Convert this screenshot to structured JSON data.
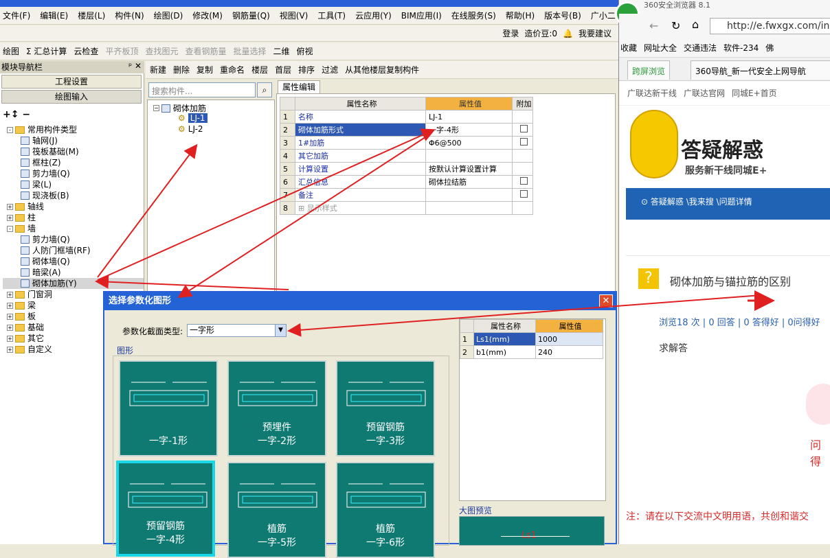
{
  "app": {
    "menu": [
      "文件(F)",
      "编辑(E)",
      "楼层(L)",
      "构件(N)",
      "绘图(D)",
      "修改(M)",
      "钢筋量(Q)",
      "视图(V)",
      "工具(T)",
      "云应用(Y)",
      "BIM应用(I)",
      "在线服务(S)",
      "帮助(H)",
      "版本号(B)",
      "广小二"
    ],
    "login": {
      "login_label": "登录",
      "price_label": "造价豆:0",
      "suggest_label": "我要建议"
    },
    "toolbar": [
      "绘图",
      "Σ 汇总计算",
      "云检查",
      "平齐板顶",
      "查找图元",
      "查看钢筋量",
      "批量选择",
      "二维",
      "俯视"
    ],
    "nav": {
      "title": "模块导航栏",
      "pin": "ᵖ ✕",
      "btn_project": "工程设置",
      "btn_draw": "绘图输入"
    },
    "tree": [
      {
        "t": "常用构件类型",
        "lvl": 0,
        "kind": "folder",
        "exp": "-"
      },
      {
        "t": "轴网(J)",
        "lvl": 1,
        "kind": "item"
      },
      {
        "t": "筏板基础(M)",
        "lvl": 1,
        "kind": "item"
      },
      {
        "t": "框柱(Z)",
        "lvl": 1,
        "kind": "item"
      },
      {
        "t": "剪力墙(Q)",
        "lvl": 1,
        "kind": "item"
      },
      {
        "t": "梁(L)",
        "lvl": 1,
        "kind": "item"
      },
      {
        "t": "现浇板(B)",
        "lvl": 1,
        "kind": "item"
      },
      {
        "t": "轴线",
        "lvl": 0,
        "kind": "folder",
        "exp": "+"
      },
      {
        "t": "柱",
        "lvl": 0,
        "kind": "folder",
        "exp": "+"
      },
      {
        "t": "墙",
        "lvl": 0,
        "kind": "folder",
        "exp": "-"
      },
      {
        "t": "剪力墙(Q)",
        "lvl": 1,
        "kind": "item"
      },
      {
        "t": "人防门框墙(RF)",
        "lvl": 1,
        "kind": "item"
      },
      {
        "t": "砌体墙(Q)",
        "lvl": 1,
        "kind": "item"
      },
      {
        "t": "暗梁(A)",
        "lvl": 1,
        "kind": "item"
      },
      {
        "t": "砌体加筋(Y)",
        "lvl": 1,
        "kind": "item",
        "selected": true
      },
      {
        "t": "门窗洞",
        "lvl": 0,
        "kind": "folder",
        "exp": "+"
      },
      {
        "t": "梁",
        "lvl": 0,
        "kind": "folder",
        "exp": "+"
      },
      {
        "t": "板",
        "lvl": 0,
        "kind": "folder",
        "exp": "+"
      },
      {
        "t": "基础",
        "lvl": 0,
        "kind": "folder",
        "exp": "+"
      },
      {
        "t": "其它",
        "lvl": 0,
        "kind": "folder",
        "exp": "+"
      },
      {
        "t": "自定义",
        "lvl": 0,
        "kind": "folder",
        "exp": "+"
      }
    ],
    "compbar": [
      "新建",
      "删除",
      "复制",
      "重命名",
      "楼层",
      "首层",
      "排序",
      "过滤",
      "从其他楼层复制构件"
    ],
    "search_placeholder": "搜索构件...",
    "comptree": {
      "root": "砌体加筋",
      "items": [
        "LJ-1",
        "LJ-2"
      ]
    },
    "prop": {
      "tab": "属性编辑",
      "headers": [
        "属性名称",
        "属性值",
        "附加"
      ],
      "rows": [
        {
          "n": "1",
          "name": "名称",
          "val": "LJ-1",
          "cb": false
        },
        {
          "n": "2",
          "name": "砌体加筋形式",
          "val": "一字-4形",
          "cb": true
        },
        {
          "n": "3",
          "name": "1#加筋",
          "val": "Φ6@500",
          "cb": true
        },
        {
          "n": "4",
          "name": "其它加筋",
          "val": "",
          "cb": false
        },
        {
          "n": "5",
          "name": "计算设置",
          "val": "按默认计算设置计算",
          "cb": false
        },
        {
          "n": "6",
          "name": "汇总信息",
          "val": "砌体拉结筋",
          "cb": true
        },
        {
          "n": "7",
          "name": "备注",
          "val": "",
          "cb": true
        },
        {
          "n": "8",
          "name": "显示样式",
          "val": "",
          "cb": false
        }
      ]
    }
  },
  "dialog": {
    "title": "选择参数化图形",
    "type_label": "参数化截面类型:",
    "type_value": "一字形",
    "group_label": "图形",
    "shapes": [
      {
        "l1": "",
        "l2": "一字-1形"
      },
      {
        "l1": "预埋件",
        "l2": "一字-2形"
      },
      {
        "l1": "预留钢筋",
        "l2": "一字-3形"
      },
      {
        "l1": "预留钢筋",
        "l2": "一字-4形",
        "selected": true
      },
      {
        "l1": "植筋",
        "l2": "一字-5形"
      },
      {
        "l1": "植筋",
        "l2": "一字-6形"
      }
    ],
    "param_headers": [
      "属性名称",
      "属性值"
    ],
    "params": [
      {
        "n": "1",
        "name": "Ls1(mm)",
        "val": "1000"
      },
      {
        "n": "2",
        "name": "b1(mm)",
        "val": "240"
      }
    ],
    "preview_label": "大图预览",
    "preview_text": "Ls1"
  },
  "browser": {
    "title": "360安全浏览器 8.1",
    "url": "http://e.fwxgx.com/inde",
    "fav": [
      "收藏",
      "网址大全",
      "交通违法",
      "软件-234",
      "佛"
    ],
    "tabs": [
      "跨屏浏览",
      "360导航_新一代安全上网导航"
    ],
    "site_links": [
      "广联达新干线",
      "广联达官网",
      "同城E+首页"
    ],
    "banner_title": "答疑解惑",
    "banner_sub": "服务新干线同城E+",
    "breadcrumb": "答疑解惑 \\我来搜 \\问题详情",
    "question": "砌体加筋与锚拉筋的区别",
    "stats": "浏览18 次 | 0 回答 | 0 答得好 | 0问得好",
    "ask": "求解答",
    "side_text": "问得",
    "notice": "注：请在以下交流中文明用语，共创和谐交"
  },
  "colors": {
    "accent": "#2463d6",
    "teal": "#0f7a72",
    "orange": "#f3b13f",
    "arrow": "#e02020"
  }
}
